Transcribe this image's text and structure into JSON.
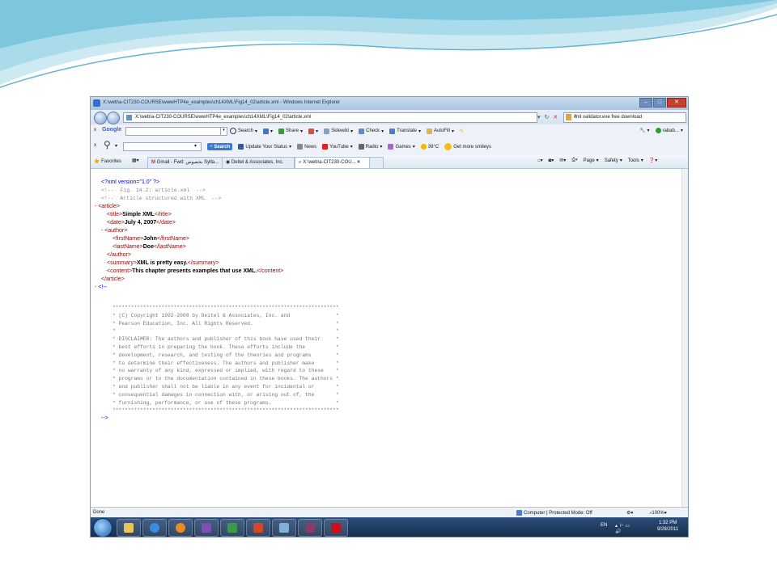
{
  "window": {
    "title": "X:\\web\\a-CIT230-COURSE\\wwwHTP4e_examples\\ch14XML\\Fig14_02\\article.xml - Windows Internet Explorer"
  },
  "address": {
    "url": "X:\\web\\a-CIT230-COURSE\\wwwHTP4e_examples\\ch14XML\\Fig14_02\\article.xml",
    "search_text": "xml validator.exe free download"
  },
  "google_toolbar": {
    "close": "x",
    "brand": "Google",
    "search": "Search",
    "share": "Share",
    "sidewiki": "Sidewiki",
    "check": "Check",
    "translate": "Translate",
    "autofill": "AutoFill",
    "user": "rabab..."
  },
  "yahoo_toolbar": {
    "close": "x",
    "search_btn": "Search",
    "items": [
      "Update Your Status",
      "News",
      "YouTube",
      "Radio",
      "Games",
      "39°C",
      "Get more smileys"
    ]
  },
  "favorites_bar": {
    "favorites": "Favorites",
    "tabs": [
      "Gmail - Fwd: بخصوص Sylla...",
      "Deitel & Associates, Inc.",
      "X:\\web\\a-CIT230-COU..."
    ],
    "tools": [
      "Page",
      "Safety",
      "Tools"
    ]
  },
  "xml": {
    "l1": "<?xml version=\"1.0\" ?>",
    "l2": "<!--  Fig. 14.2: article.xml  -->",
    "l3": "<!--  Article structured with XML  -->",
    "l4_minus": "-",
    "l4": "<article>",
    "title_open": "<title>",
    "title_val": "Simple XML",
    "title_close": "</title>",
    "date_open": "<date>",
    "date_val": "July 4, 2007",
    "date_close": "</date>",
    "author_minus": "-",
    "author_open": "<author>",
    "fn_open": "<firstName>",
    "fn_val": "John",
    "fn_close": "</firstName>",
    "ln_open": "<lastName>",
    "ln_val": "Doe",
    "ln_close": "</lastName>",
    "author_close": "</author>",
    "sum_open": "<summary>",
    "sum_val": "XML is pretty easy.",
    "sum_close": "</summary>",
    "con_open": "<content>",
    "con_val": "This chapter presents examples that use XML.",
    "con_close": "</content>",
    "article_close": "</article>",
    "cm_minus": "-",
    "cm_open": "<!--",
    "legal": "**************************************************************************\n* (C) Copyright 1992-2008 by Deitel & Associates, Inc. and               *\n* Pearson Education, Inc. All Rights Reserved.                           *\n*                                                                        *\n* DISCLAIMER: The authors and publisher of this book have used their     *\n* best efforts in preparing the book. These efforts include the          *\n* development, research, and testing of the theories and programs        *\n* to determine their effectiveness. The authors and publisher make       *\n* no warranty of any kind, expressed or implied, with regard to these    *\n* programs or to the documentation contained in these books. The authors *\n* and publisher shall not be liable in any event for incidental or       *\n* consequential damages in connection with, or arising out of, the       *\n* furnishing, performance, or use of these programs.                     *\n**************************************************************************",
    "cm_close": "-->"
  },
  "status": {
    "left": "Done",
    "zone": "Computer | Protected Mode: Off",
    "zoom": "100%"
  },
  "taskbar": {
    "lang": "EN",
    "time": "1:32 PM",
    "date": "9/28/2011"
  },
  "colors": {
    "tag": "#990000",
    "pi": "#0000ff",
    "comment": "#888888"
  }
}
